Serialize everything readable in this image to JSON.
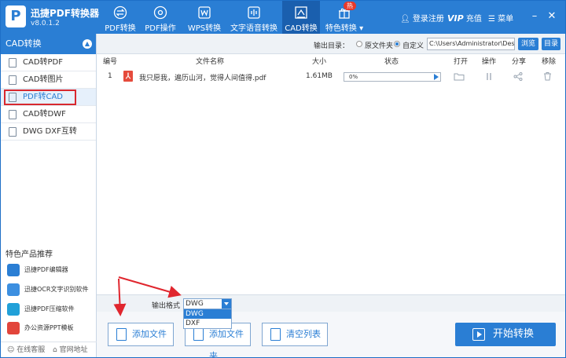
{
  "app": {
    "name": "迅捷PDF转换器",
    "version": "v8.0.1.2",
    "logo_letter": "P"
  },
  "nav": {
    "tabs": [
      {
        "label": "PDF转换",
        "icon": "swap-icon"
      },
      {
        "label": "PDF操作",
        "icon": "gear-icon"
      },
      {
        "label": "WPS转换",
        "icon": "w-doc-icon"
      },
      {
        "label": "文字语音转换",
        "icon": "audio-icon"
      },
      {
        "label": "CAD转换",
        "icon": "cad-icon"
      },
      {
        "label": "特色转换",
        "icon": "gift-icon"
      }
    ],
    "active_tab": "CAD转换",
    "hot_badge": "热",
    "login": "登录注册",
    "vip": "VIP",
    "recharge": "充值",
    "menu": "菜单",
    "minimize": "–",
    "close": "✕"
  },
  "sidebar": {
    "header": "CAD转换",
    "items": [
      {
        "label": "CAD转PDF"
      },
      {
        "label": "CAD转图片"
      },
      {
        "label": "PDF转CAD"
      },
      {
        "label": "CAD转DWF"
      },
      {
        "label": "DWG DXF互转"
      }
    ],
    "active": "PDF转CAD",
    "featured_title": "特色产品推荐",
    "featured": [
      {
        "label": "迅捷PDF编辑器",
        "color": "#2a7ed4"
      },
      {
        "label": "迅捷OCR文字识别软件",
        "color": "#3c8fe0"
      },
      {
        "label": "迅捷PDF压缩软件",
        "color": "#21a0d8"
      },
      {
        "label": "办公资源PPT模板",
        "color": "#e2453b"
      }
    ],
    "footer": {
      "service": "在线客服",
      "website": "官网地址"
    }
  },
  "output": {
    "label": "输出目录：",
    "option_original": "原文件夹",
    "option_custom": "自定义",
    "selected": "自定义",
    "path": "C:\\Users\\Administrator\\Deskto",
    "browse": "浏览",
    "directory": "目录"
  },
  "table": {
    "headers": {
      "index": "编号",
      "name": "文件名称",
      "size": "大小",
      "status": "状态",
      "open": "打开",
      "action": "操作",
      "share": "分享",
      "remove": "移除"
    },
    "rows": [
      {
        "index": "1",
        "name": "我只愿我，遍历山河，觉得人间值得.pdf",
        "size": "1.61MB",
        "progress": "0%"
      }
    ]
  },
  "format": {
    "label": "输出格式",
    "selected": "DWG",
    "options": [
      "DWG",
      "DXF"
    ]
  },
  "actions": {
    "add_file": "添加文件",
    "add_folder": "添加文件夹",
    "clear_list": "清空列表",
    "start": "开始转换"
  },
  "colors": {
    "primary": "#2a7ed4",
    "dark_tab": "#1a5fae",
    "accent_red": "#d8282e"
  }
}
